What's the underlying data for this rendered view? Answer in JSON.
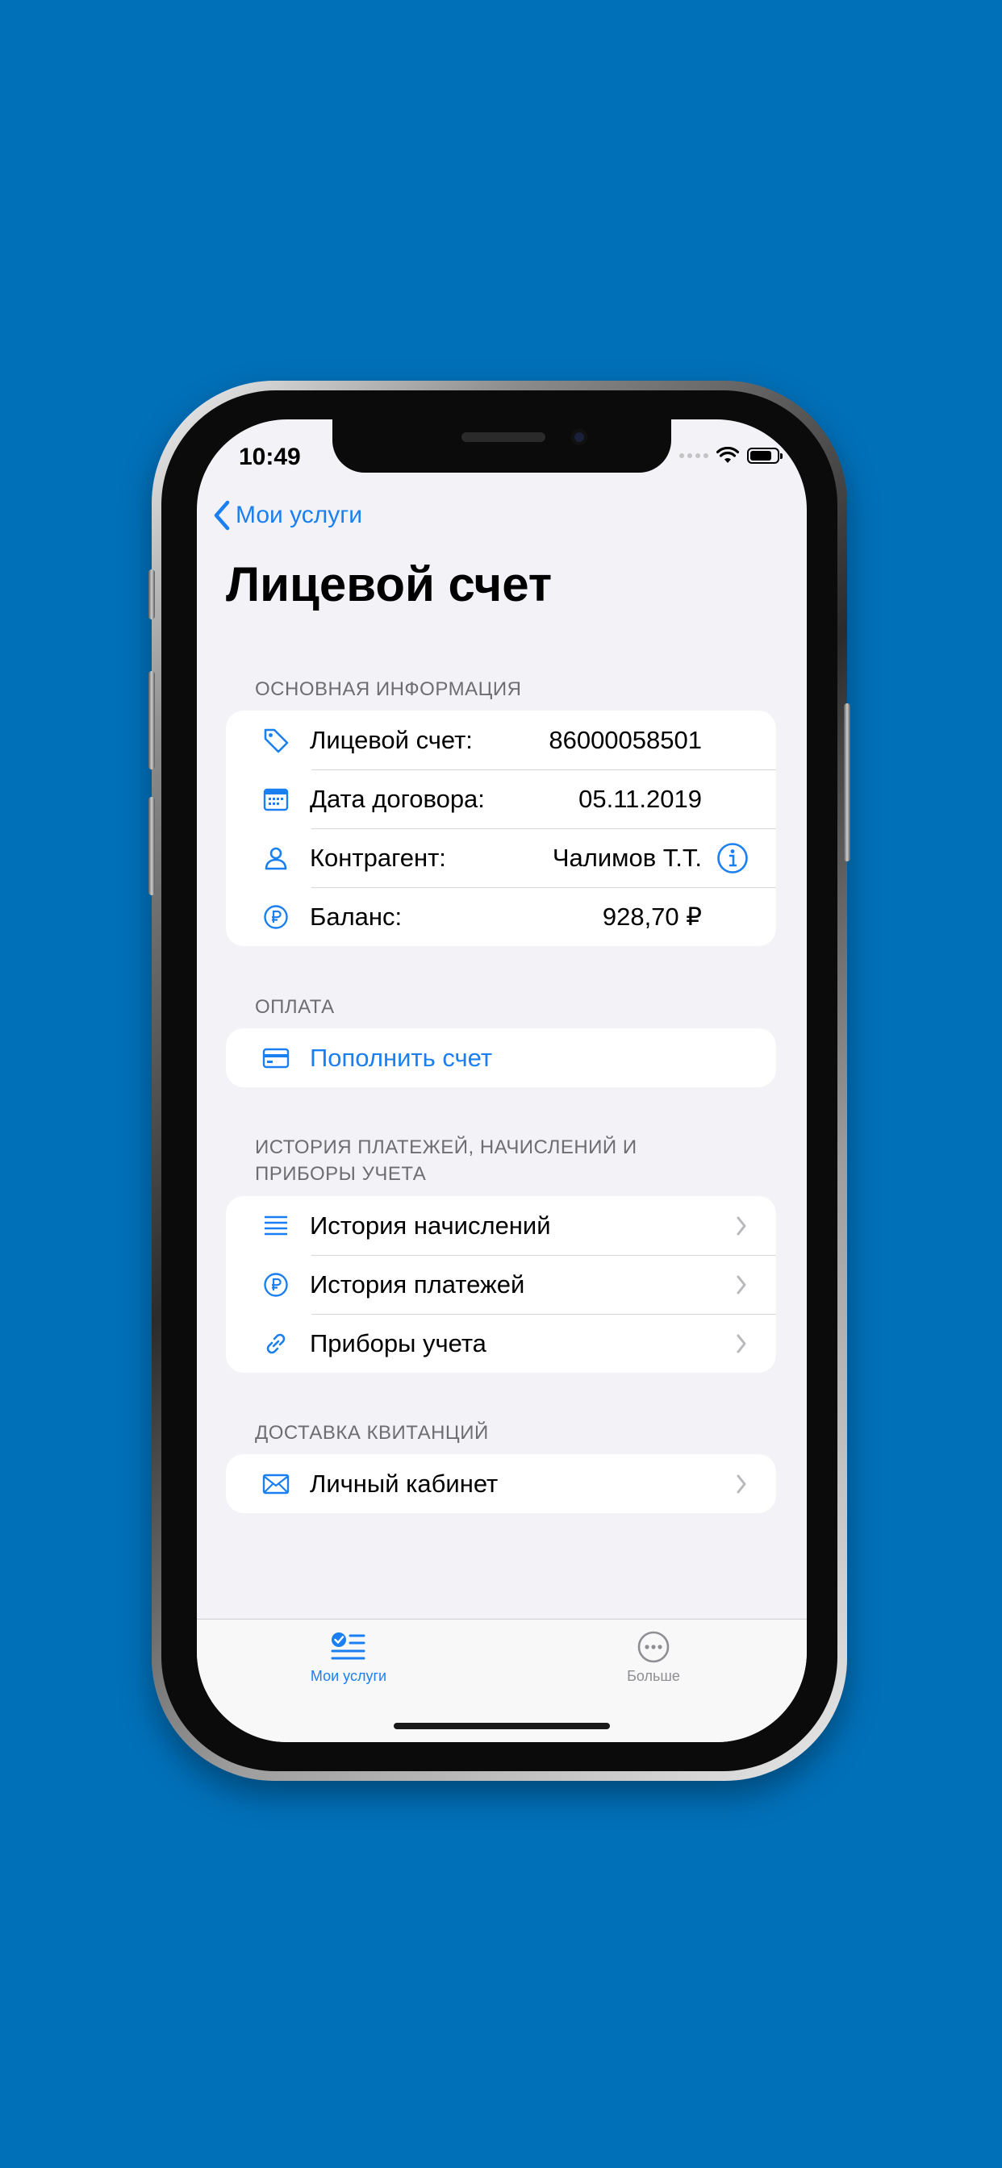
{
  "status_bar": {
    "time": "10:49"
  },
  "nav": {
    "back_label": "Мои услуги"
  },
  "page": {
    "title": "Лицевой счет"
  },
  "sections": {
    "main_info": {
      "header": "ОСНОВНАЯ ИНФОРМАЦИЯ",
      "rows": [
        {
          "label": "Лицевой счет:",
          "value": "86000058501",
          "icon": "tag-icon"
        },
        {
          "label": "Дата договора:",
          "value": "05.11.2019",
          "icon": "calendar-icon"
        },
        {
          "label": "Контрагент:",
          "value": "Чалимов Т.Т.",
          "icon": "person-icon"
        },
        {
          "label": "Баланс:",
          "value": "928,70 ₽",
          "icon": "ruble-icon"
        }
      ]
    },
    "payment": {
      "header": "ОПЛАТА",
      "rows": [
        {
          "label": "Пополнить счет",
          "icon": "credit-card-icon"
        }
      ]
    },
    "history": {
      "header": "ИСТОРИЯ ПЛАТЕЖЕЙ, НАЧИСЛЕНИЙ И ПРИБОРЫ УЧЕТА",
      "rows": [
        {
          "label": "История начислений",
          "icon": "list-icon"
        },
        {
          "label": "История платежей",
          "icon": "ruble-icon"
        },
        {
          "label": "Приборы учета",
          "icon": "link-icon"
        }
      ]
    },
    "delivery": {
      "header": "ДОСТАВКА КВИТАНЦИЙ",
      "rows": [
        {
          "label": "Личный кабинет",
          "icon": "envelope-icon"
        }
      ]
    }
  },
  "tabbar": {
    "tabs": [
      {
        "label": "Мои услуги",
        "active": true,
        "icon": "services-list-icon"
      },
      {
        "label": "Больше",
        "active": false,
        "icon": "more-icon"
      }
    ]
  },
  "colors": {
    "background": "#0070b9",
    "accent": "#1a7ff0",
    "screen_bg": "#f2f2f7"
  }
}
